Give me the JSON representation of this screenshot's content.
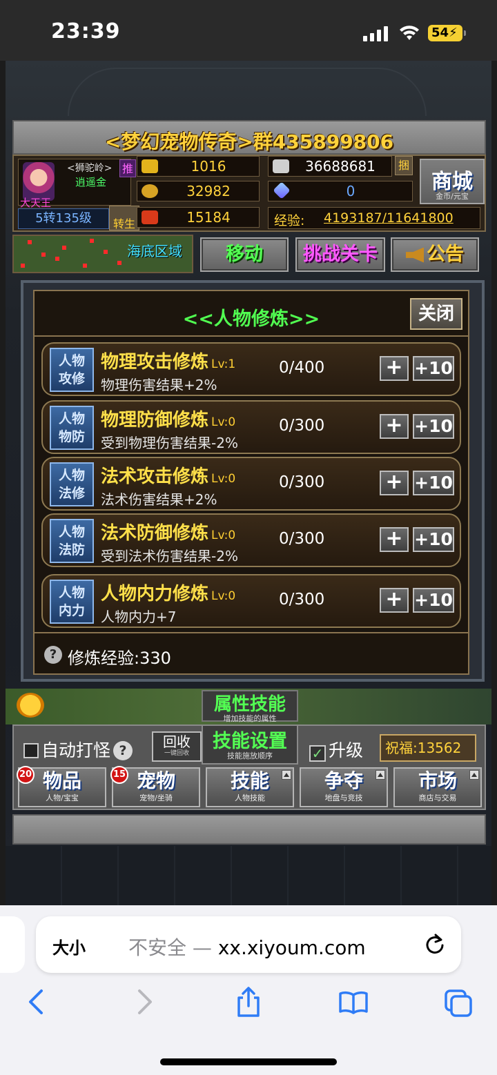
{
  "status_bar": {
    "time": "23:39",
    "battery": "54"
  },
  "game": {
    "title": "<梦幻宠物传奇>群435899806",
    "player": {
      "name": "大天王",
      "clan": "<狮驼岭>",
      "title": "逍遥金",
      "push_label": "推",
      "level": "5转135级",
      "rebirth_label": "转生"
    },
    "resources": {
      "gold": "1016",
      "silver": "36688681",
      "bind_label": "捆",
      "ingot": "32982",
      "gem": "0",
      "battle": "15184",
      "exp_label": "经验:",
      "exp_value": "4193187/11641800"
    },
    "shop": {
      "label": "商城",
      "sub": "金币/元宝"
    },
    "map_name": "海底区域",
    "actions": {
      "move": "移动",
      "challenge": "挑战关卡",
      "notice": "公告"
    },
    "training": {
      "title": "<<人物修炼>>",
      "close": "关闭",
      "items": [
        {
          "icon": [
            "人物",
            "攻修"
          ],
          "name": "物理攻击修炼",
          "lv": "Lv:1",
          "desc": "物理伤害结果+2%",
          "progress": "0/400",
          "plus": "+",
          "plus10": "+10"
        },
        {
          "icon": [
            "人物",
            "物防"
          ],
          "name": "物理防御修炼",
          "lv": "Lv:0",
          "desc": "受到物理伤害结果-2%",
          "progress": "0/300",
          "plus": "+",
          "plus10": "+10"
        },
        {
          "icon": [
            "人物",
            "法修"
          ],
          "name": "法术攻击修炼",
          "lv": "Lv:0",
          "desc": "法术伤害结果+2%",
          "progress": "0/300",
          "plus": "+",
          "plus10": "+10"
        },
        {
          "icon": [
            "人物",
            "法防"
          ],
          "name": "法术防御修炼",
          "lv": "Lv:0",
          "desc": "受到法术伤害结果-2%",
          "progress": "0/300",
          "plus": "+",
          "plus10": "+10"
        },
        {
          "icon": [
            "人物",
            "内力"
          ],
          "name": "人物内力修炼",
          "lv": "Lv:0",
          "desc": "人物内力+7",
          "progress": "0/300",
          "plus": "+",
          "plus10": "+10"
        }
      ],
      "footer_help": "?",
      "footer": "修炼经验:330"
    },
    "tabs": {
      "attr_skill": "属性技能",
      "attr_skill_sub": "增加技能的属性",
      "auto_fight": "自动打怪",
      "help": "?",
      "recycle": "回收",
      "recycle_sub": "一键回收",
      "skill_setting": "技能设置",
      "skill_setting_sub": "技能施放顺序",
      "upgrade": "升级",
      "blessing": "祝福:13562"
    },
    "menu": [
      {
        "label": "物品",
        "sub": "人物/宝宝",
        "badge": "20"
      },
      {
        "label": "宠物",
        "sub": "宠物/坐骑",
        "badge": "15"
      },
      {
        "label": "技能",
        "sub": "人物技能",
        "badge": ""
      },
      {
        "label": "争夺",
        "sub": "地盘与竞技",
        "badge": ""
      },
      {
        "label": "市场",
        "sub": "商店与交易",
        "badge": ""
      }
    ]
  },
  "browser": {
    "text_size": "大小",
    "insecure": "不安全 —",
    "domain": "xx.xiyoum.com"
  }
}
